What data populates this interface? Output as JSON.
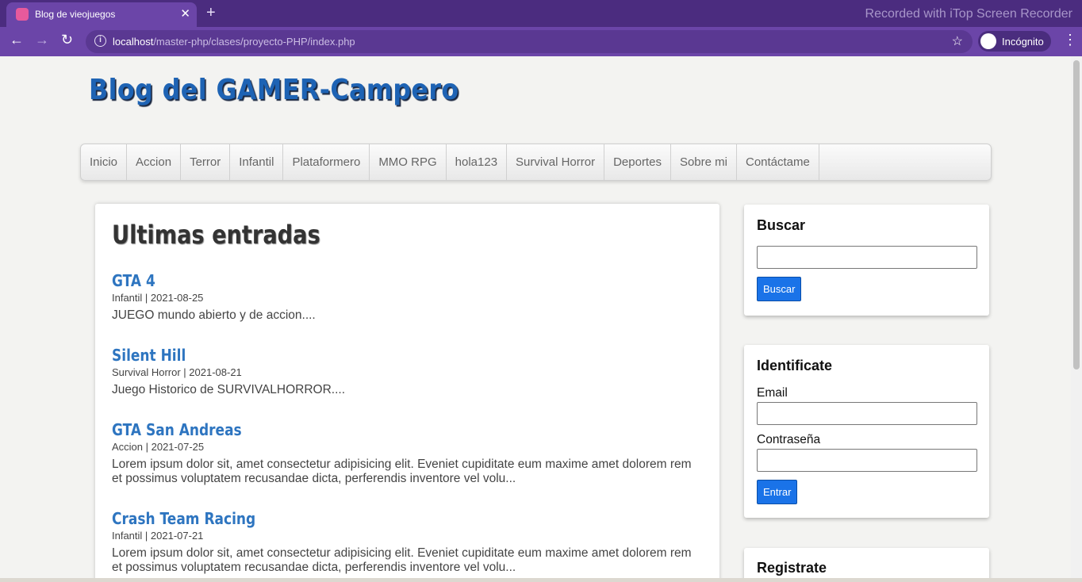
{
  "browser": {
    "tab_title": "Blog de vieojuegos",
    "tab_close": "✕",
    "new_tab": "+",
    "url_host": "localhost",
    "url_path": "/master-php/clases/proyecto-PHP/index.php",
    "incognito_label": "Incógnito",
    "recorder_watermark": "Recorded with iTop Screen Recorder"
  },
  "site": {
    "title": "Blog del GAMER-Campero"
  },
  "menu": {
    "items": [
      "Inicio",
      "Accion",
      "Terror",
      "Infantil",
      "Plataformero",
      "MMO RPG",
      "hola123",
      "Survival Horror",
      "Deportes",
      "Sobre mi",
      "Contáctame"
    ]
  },
  "main": {
    "heading": "Ultimas entradas",
    "entries": [
      {
        "title": "GTA 4",
        "meta": "Infantil | 2021-08-25",
        "desc": "JUEGO mundo abierto y de accion...."
      },
      {
        "title": "Silent Hill",
        "meta": "Survival Horror | 2021-08-21",
        "desc": "Juego Historico de SURVIVALHORROR...."
      },
      {
        "title": "GTA San Andreas",
        "meta": "Accion | 2021-07-25",
        "desc": "Lorem ipsum dolor sit, amet consectetur adipisicing elit. Eveniet cupiditate eum maxime amet dolorem rem et possimus voluptatem recusandae dicta, perferendis inventore vel volu..."
      },
      {
        "title": "Crash Team Racing",
        "meta": "Infantil | 2021-07-21",
        "desc": "Lorem ipsum dolor sit, amet consectetur adipisicing elit. Eveniet cupiditate eum maxime amet dolorem rem et possimus voluptatem recusandae dicta, perferendis inventore vel volu..."
      }
    ]
  },
  "sidebar": {
    "search": {
      "title": "Buscar",
      "button": "Buscar",
      "value": ""
    },
    "login": {
      "title": "Identificate",
      "email_label": "Email",
      "password_label": "Contraseña",
      "button": "Entrar"
    },
    "register": {
      "title": "Registrate"
    }
  },
  "icons": {
    "back": "arrow-left-icon",
    "forward": "arrow-right-icon",
    "reload": "reload-icon",
    "info": "info-icon",
    "bookmark": "star-icon",
    "incognito": "incognito-icon",
    "menu": "kebab-menu-icon"
  },
  "colors": {
    "chrome_accent": "#6b45a8",
    "tabbar": "#4b2c7f",
    "title_blue": "#1e63b4",
    "link_blue": "#2e75c0",
    "button_blue": "#1a73e8"
  }
}
